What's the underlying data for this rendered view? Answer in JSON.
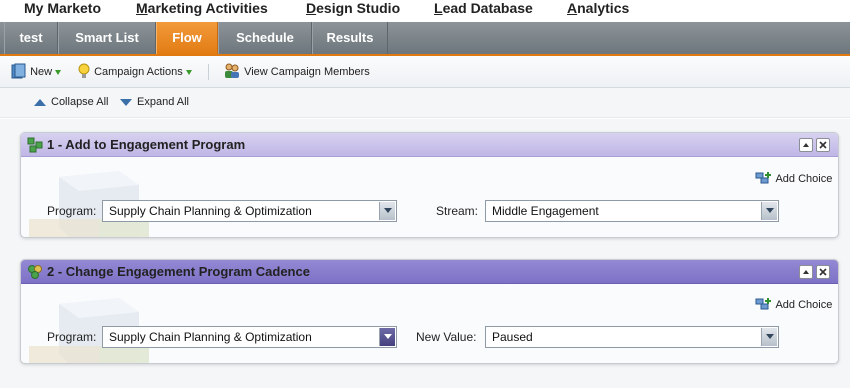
{
  "topnav": {
    "items": [
      {
        "label": "My Marketo"
      },
      {
        "label": "Marketing Activities",
        "ul": "M",
        "rest": "arketing Activities"
      },
      {
        "label": "Design Studio",
        "ul": "D",
        "rest": "esign Studio"
      },
      {
        "label": "Lead Database",
        "ul": "L",
        "rest": "ead Database"
      },
      {
        "label": "Analytics",
        "ul": "A",
        "rest": "nalytics"
      }
    ]
  },
  "tabs": [
    {
      "label": "test"
    },
    {
      "label": "Smart List"
    },
    {
      "label": "Flow",
      "active": true
    },
    {
      "label": "Schedule"
    },
    {
      "label": "Results"
    }
  ],
  "toolbar": {
    "new_label": "New",
    "campaign_actions_label": "Campaign Actions",
    "view_members_label": "View Campaign Members"
  },
  "collapse_label": "Collapse All",
  "expand_label": "Expand All",
  "steps": [
    {
      "title": "1 - Add to Engagement Program",
      "add_choice": "Add Choice",
      "program_label": "Program:",
      "program_value": "Supply Chain Planning & Optimization",
      "second_label": "Stream:",
      "second_value": "Middle Engagement"
    },
    {
      "title": "2 - Change Engagement Program Cadence",
      "add_choice": "Add Choice",
      "program_label": "Program:",
      "program_value": "Supply Chain Planning & Optimization",
      "second_label": "New Value:",
      "second_value": "Paused"
    }
  ],
  "colors": {
    "accent_orange": "#e27c14",
    "header_light": "#bfb6e6",
    "header_dark": "#7d71c6",
    "link_blue": "#3a6fa8"
  },
  "icons": [
    "new-icon",
    "lightbulb-icon",
    "people-icon",
    "flow-step-icon",
    "collapse-icon",
    "expand-icon",
    "add-choice-icon",
    "minimize-icon",
    "close-icon",
    "dropdown-arrow-icon"
  ]
}
